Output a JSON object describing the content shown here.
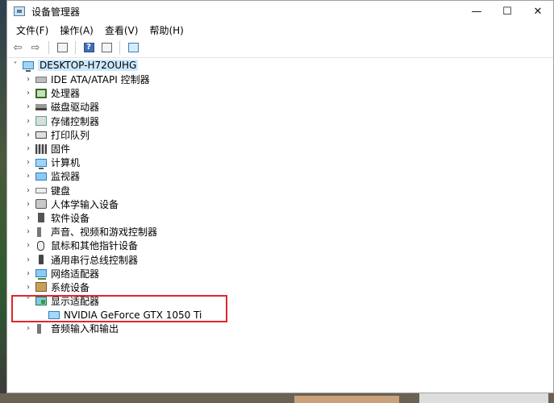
{
  "window": {
    "title": "设备管理器",
    "controls": {
      "minimize": "—",
      "maximize": "☐",
      "close": "✕"
    }
  },
  "menu": [
    "文件(F)",
    "操作(A)",
    "查看(V)",
    "帮助(H)"
  ],
  "toolbar_help": "?",
  "tree": {
    "root": "DESKTOP-H72OUHG",
    "categories": [
      {
        "label": "IDE ATA/ATAPI 控制器",
        "icon": "ide-controller-icon"
      },
      {
        "label": "处理器",
        "icon": "processor-icon"
      },
      {
        "label": "磁盘驱动器",
        "icon": "disk-drive-icon"
      },
      {
        "label": "存储控制器",
        "icon": "storage-controller-icon"
      },
      {
        "label": "打印队列",
        "icon": "printer-icon"
      },
      {
        "label": "固件",
        "icon": "firmware-icon"
      },
      {
        "label": "计算机",
        "icon": "computer-icon"
      },
      {
        "label": "监视器",
        "icon": "monitor-icon"
      },
      {
        "label": "键盘",
        "icon": "keyboard-icon"
      },
      {
        "label": "人体学输入设备",
        "icon": "hid-icon"
      },
      {
        "label": "软件设备",
        "icon": "software-device-icon"
      },
      {
        "label": "声音、视频和游戏控制器",
        "icon": "audio-icon"
      },
      {
        "label": "鼠标和其他指针设备",
        "icon": "mouse-icon"
      },
      {
        "label": "通用串行总线控制器",
        "icon": "usb-icon"
      },
      {
        "label": "网络适配器",
        "icon": "network-adapter-icon"
      },
      {
        "label": "系统设备",
        "icon": "system-device-icon"
      },
      {
        "label": "显示适配器",
        "icon": "display-adapter-icon",
        "expanded": true
      },
      {
        "label": "NVIDIA GeForce GTX 1050 Ti",
        "icon": "gpu-icon",
        "child": true
      },
      {
        "label": "音频输入和输出",
        "icon": "audio-io-icon"
      }
    ]
  },
  "chevrons": {
    "collapsed": "›",
    "expanded": "˅"
  },
  "colors": {
    "highlight_border": "#e0262b",
    "root_selection": "#cce8ff"
  }
}
